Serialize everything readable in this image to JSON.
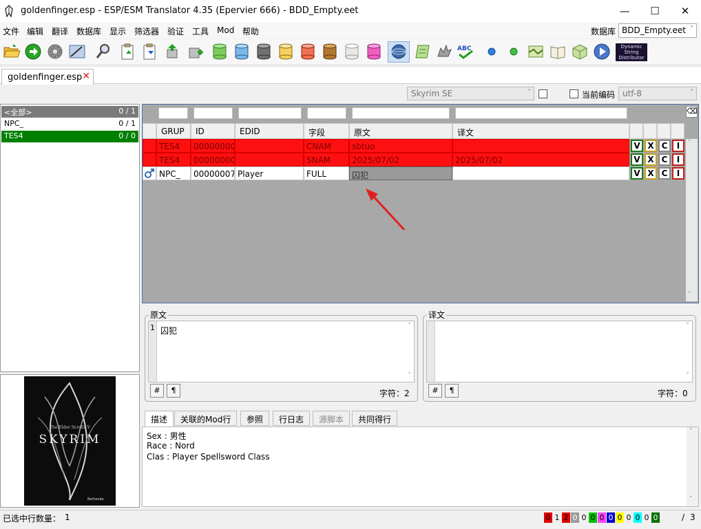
{
  "window": {
    "title": "goldenfinger.esp - ESP/ESM Translator 4.35 (Epervier 666) - BDD_Empty.eet",
    "minimize": "—",
    "maximize": "☐",
    "close": "✕"
  },
  "menu": [
    "文件",
    "编辑",
    "翻译",
    "数据库",
    "显示",
    "筛选器",
    "验证",
    "工具",
    "Mod",
    "帮助"
  ],
  "database": {
    "label": "数据库",
    "value": "BDD_Empty.eet"
  },
  "toolbar": {
    "dsd_logo": [
      "Dynamic",
      "String",
      "Distributor"
    ],
    "abc_label": "ABC"
  },
  "file_tab": {
    "label": "goldenfinger.esp",
    "close": "✕"
  },
  "encoding": {
    "game": "Skyrim SE",
    "current_label": "当前编码",
    "encoding": "utf-8"
  },
  "categories": [
    {
      "name": "<全部>",
      "count": "0 / 1"
    },
    {
      "name": "NPC_",
      "count": "0 / 1"
    },
    {
      "name": "TES4",
      "count": "0 / 0"
    }
  ],
  "poster": {
    "subtitle": "The Elder Scrolls V",
    "title": "SKYRIM",
    "publisher": "Bethesda"
  },
  "grid": {
    "columns": [
      "GRUP",
      "ID",
      "EDID",
      "字段",
      "原文",
      "译文"
    ],
    "rows": [
      {
        "grup": "TES4",
        "id": "00000000",
        "edid": "",
        "field": "CNAM",
        "source": "sbtuo",
        "target": "",
        "v": "V",
        "x": "X",
        "c": "C",
        "i": "I"
      },
      {
        "grup": "TES4",
        "id": "00000000",
        "edid": "",
        "field": "SNAM",
        "source": "2025/07/02",
        "target": "2025/07/02",
        "v": "V",
        "x": "X",
        "c": "C",
        "i": "I"
      },
      {
        "grup": "NPC_",
        "id": "00000007",
        "edid": "Player",
        "field": "FULL",
        "source": "囚犯",
        "target": "",
        "v": "V",
        "x": "X",
        "c": "C",
        "i": "I"
      }
    ]
  },
  "source_panel": {
    "title": "原文",
    "line_no": "1",
    "text": "囚犯",
    "hash": "#",
    "pilcrow": "¶",
    "char_count": "字符：2"
  },
  "target_panel": {
    "title": "译文",
    "text": "",
    "hash": "#",
    "pilcrow": "¶",
    "char_count": "字符：0"
  },
  "bottom_tabs": [
    "描述",
    "关联的Mod行",
    "参照",
    "行日志",
    "源脚本",
    "共同得行"
  ],
  "description": [
    "Sex : 男性",
    "Race : Nord",
    "Clas : Player Spellsword Class"
  ],
  "status": {
    "selected_label": "已选中行数量：",
    "selected_count": "1",
    "counters": [
      {
        "value": "0",
        "bg": "#e00000",
        "fg": "#000000"
      },
      {
        "value": "1",
        "bg": "#f0f0f0",
        "fg": "#000000"
      },
      {
        "value": "2",
        "bg": "#e00000",
        "fg": "#000000"
      },
      {
        "value": "0",
        "bg": "#9a9a9a",
        "fg": "#ffffff"
      },
      {
        "value": "0",
        "bg": "#f0f0f0",
        "fg": "#000000"
      },
      {
        "value": "0",
        "bg": "#00c000",
        "fg": "#000000"
      },
      {
        "value": "0",
        "bg": "#ff40ff",
        "fg": "#000000"
      },
      {
        "value": "0",
        "bg": "#0000d0",
        "fg": "#ffffff"
      },
      {
        "value": "0",
        "bg": "#ffff00",
        "fg": "#000000"
      },
      {
        "value": "0",
        "bg": "#f0f0f0",
        "fg": "#000000"
      },
      {
        "value": "0",
        "bg": "#00ffff",
        "fg": "#000000"
      },
      {
        "value": "0",
        "bg": "#f0f0f0",
        "fg": "#000000"
      },
      {
        "value": "0",
        "bg": "#007000",
        "fg": "#ffffff"
      }
    ],
    "total_sep": "/",
    "total": "3"
  },
  "colors": {
    "error_red": "#ff1010",
    "selected_green": "#008000",
    "accent_blue": "#4a6fa5"
  }
}
